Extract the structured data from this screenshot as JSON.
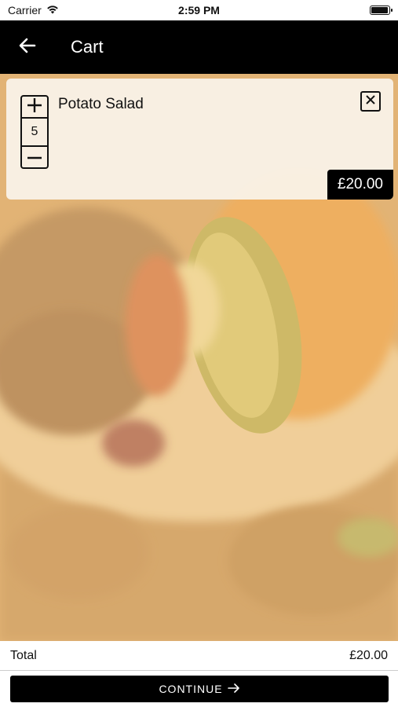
{
  "status_bar": {
    "carrier": "Carrier",
    "time": "2:59 PM",
    "battery_level": 0.95
  },
  "nav": {
    "title": "Cart",
    "back_icon": "arrow-left-icon"
  },
  "cart": {
    "items": [
      {
        "name": "Potato Salad",
        "quantity": "5",
        "price": "£20.00"
      }
    ]
  },
  "summary": {
    "total_label": "Total",
    "total_value": "£20.00"
  },
  "actions": {
    "continue_label": "CONTINUE",
    "continue_icon": "arrow-right-icon"
  },
  "colors": {
    "nav_background": "#000000",
    "overlay_tint": "#f5cd8c",
    "button_background": "#000000"
  }
}
